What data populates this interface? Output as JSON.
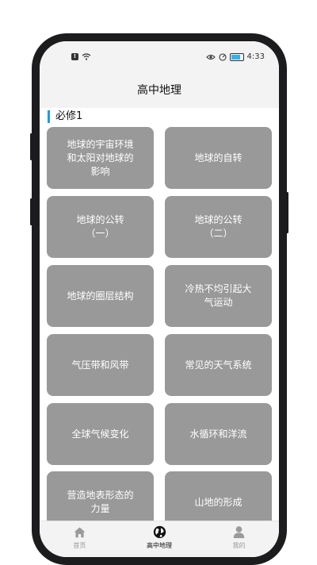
{
  "status_bar": {
    "time": "4:33",
    "icons": [
      "alert-icon",
      "wifi-icon",
      "eye-icon",
      "data-saver-icon",
      "battery-icon"
    ],
    "battery_level": 0.8,
    "accent": "#35b3e6"
  },
  "app_bar": {
    "title": "高中地理"
  },
  "section": {
    "title": "必修1",
    "accent": "#1e9be3"
  },
  "topics": [
    "地球的宇宙环境\n和太阳对地球的\n影响",
    "地球的自转",
    "地球的公转\n（一）",
    "地球的公转\n（二）",
    "地球的圈层结构",
    "冷热不均引起大\n气运动",
    "气压带和风带",
    "常见的天气系统",
    "全球气候变化",
    "水循环和洋流",
    "营造地表形态的\n力量",
    "山地的形成"
  ],
  "tab_bar": {
    "tabs": [
      {
        "label": "首页",
        "icon": "home-icon",
        "active": false
      },
      {
        "label": "高中地理",
        "icon": "globe-icon",
        "active": true
      },
      {
        "label": "我的",
        "icon": "person-icon",
        "active": false
      }
    ]
  }
}
